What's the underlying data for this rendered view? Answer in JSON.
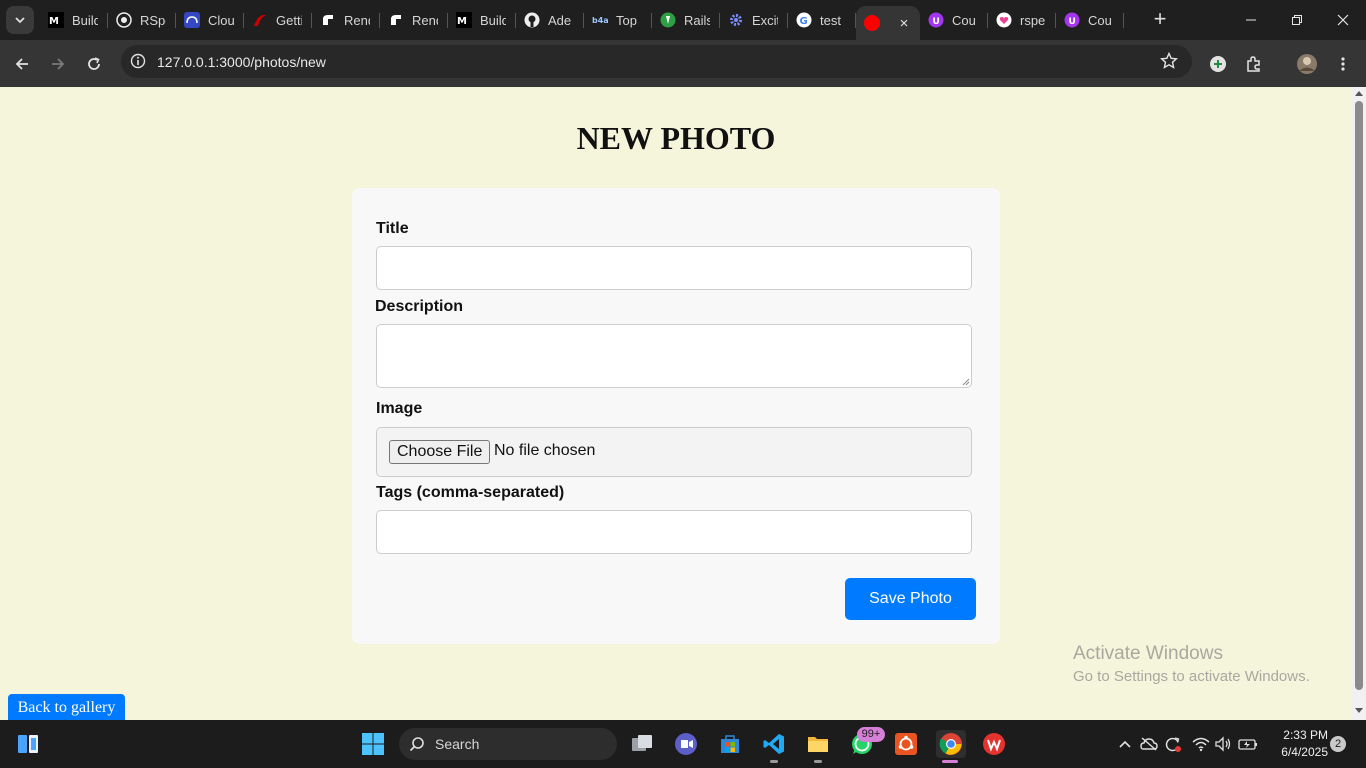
{
  "browser": {
    "tabs": [
      {
        "title": "Build",
        "icon": "medium-icon"
      },
      {
        "title": "RSpec",
        "icon": "rspec-icon"
      },
      {
        "title": "Cloud",
        "icon": "cloudinary-icon"
      },
      {
        "title": "Getting",
        "icon": "rails-guide-icon"
      },
      {
        "title": "Render",
        "icon": "render-icon"
      },
      {
        "title": "Render",
        "icon": "render-icon"
      },
      {
        "title": "Build",
        "icon": "medium-icon"
      },
      {
        "title": "Ade",
        "icon": "github-icon"
      },
      {
        "title": "Top",
        "icon": "b4a-icon"
      },
      {
        "title": "Rails",
        "icon": "railway-icon"
      },
      {
        "title": "Excit",
        "icon": "gear-icon"
      },
      {
        "title": "test",
        "icon": "google-icon"
      },
      {
        "title": "",
        "icon": "record-icon",
        "active": true
      },
      {
        "title": "Cou",
        "icon": "udemy-icon"
      },
      {
        "title": "rspe",
        "icon": "heart-icon"
      },
      {
        "title": "Cou",
        "icon": "udemy-icon"
      }
    ],
    "url": "127.0.0.1:3000/photos/new",
    "new_tab": "+",
    "close_tab": "×"
  },
  "page": {
    "title": "NEW PHOTO",
    "form": {
      "title_label": "Title",
      "title_value": "",
      "description_label": "Description",
      "description_value": "",
      "image_label": "Image",
      "file_button": "Choose File",
      "file_status": "No file chosen",
      "tags_label": "Tags (comma-separated)",
      "tags_value": "",
      "submit": "Save Photo"
    },
    "back_link": "Back to gallery",
    "watermark_title": "Activate Windows",
    "watermark_sub": "Go to Settings to activate Windows."
  },
  "colors": {
    "page_bg": "#f5f5dc",
    "card_bg": "#f8f8f8",
    "accent": "#007bff"
  },
  "taskbar": {
    "search_label": "Search",
    "whatsapp_badge": "99+",
    "time": "2:33 PM",
    "date": "6/4/2025",
    "notifications": "2"
  }
}
